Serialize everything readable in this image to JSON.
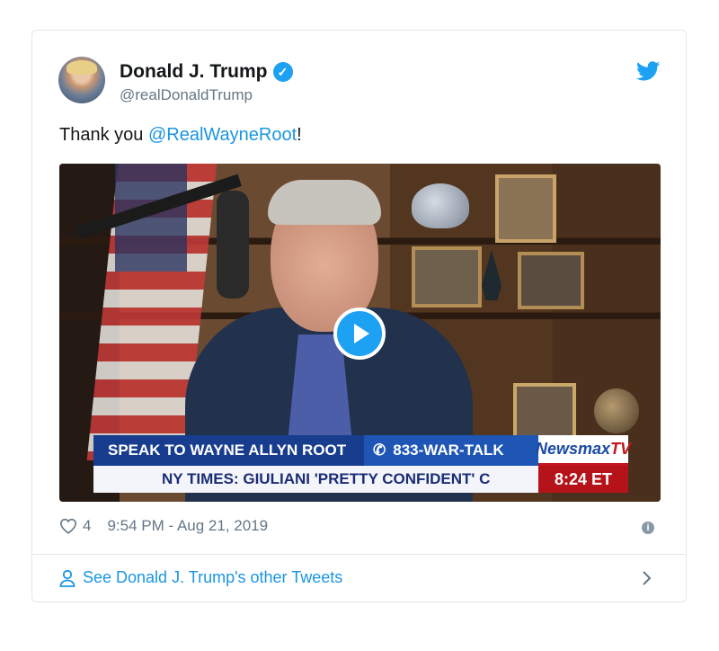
{
  "tweet": {
    "author": {
      "name": "Donald J. Trump",
      "handle": "@realDonaldTrump",
      "verified": true,
      "avatar_icon": "profile-photo"
    },
    "text_prefix": "Thank you ",
    "mention": "@RealWayneRoot",
    "text_suffix": "!",
    "media": {
      "type": "video",
      "play_icon": "play-icon",
      "overlay": {
        "headline": "SPEAK TO WAYNE ALLYN ROOT",
        "phone": "833-WAR-TALK",
        "ticker": "NY TIMES: GIULIANI 'PRETTY CONFIDENT' C",
        "brand_prefix": "Newsmax",
        "brand_suffix": "TV",
        "time": "8:24 ET"
      }
    },
    "likes": "4",
    "timestamp": "9:54 PM - Aug 21, 2019",
    "footer_link": "See Donald J. Trump's other Tweets"
  },
  "colors": {
    "accent": "#1da1f2",
    "link": "#1b95e0",
    "text": "#14171a",
    "muted": "#657786",
    "border": "#e1e8ed"
  }
}
